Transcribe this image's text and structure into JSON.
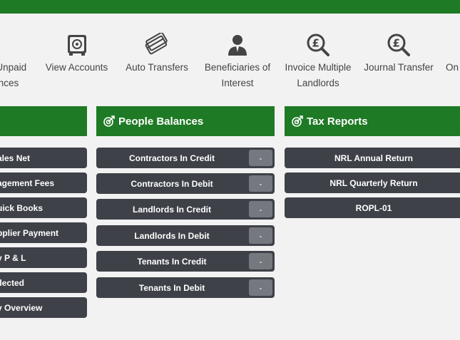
{
  "toolbar": {
    "items": [
      {
        "line1": "nUnpaid",
        "line2": "nces",
        "icon": "pound-icon"
      },
      {
        "line1": "View Accounts",
        "line2": "",
        "icon": "safe-icon"
      },
      {
        "line1": "Auto Transfers",
        "line2": "",
        "icon": "cards-icon"
      },
      {
        "line1": "Beneficiaries of",
        "line2": "Interest",
        "icon": "person-icon"
      },
      {
        "line1": "Invoice Multiple",
        "line2": "Landlords",
        "icon": "pound-search-icon"
      },
      {
        "line1": "Journal Transfer",
        "line2": "",
        "icon": "pound-search-icon"
      },
      {
        "line1": "On",
        "line2": "",
        "icon": ""
      }
    ]
  },
  "left_panel": {
    "buttons": [
      "ales Net",
      "agement Fees",
      "uick Books",
      "pplier Payment",
      "y P & L",
      "llected",
      "y Overview"
    ]
  },
  "people_balances": {
    "title": "People Balances",
    "buttons": [
      {
        "label": "Contractors In Credit",
        "count": "-"
      },
      {
        "label": "Contractors In Debit",
        "count": "-"
      },
      {
        "label": "Landlords In Credit",
        "count": "-"
      },
      {
        "label": "Landlords In Debit",
        "count": "-"
      },
      {
        "label": "Tenants In Credit",
        "count": "-"
      },
      {
        "label": "Tenants In Debit",
        "count": "-"
      }
    ]
  },
  "tax_reports": {
    "title": "Tax Reports",
    "buttons": [
      "NRL Annual Return",
      "NRL Quarterly Return",
      "ROPL-01"
    ]
  }
}
